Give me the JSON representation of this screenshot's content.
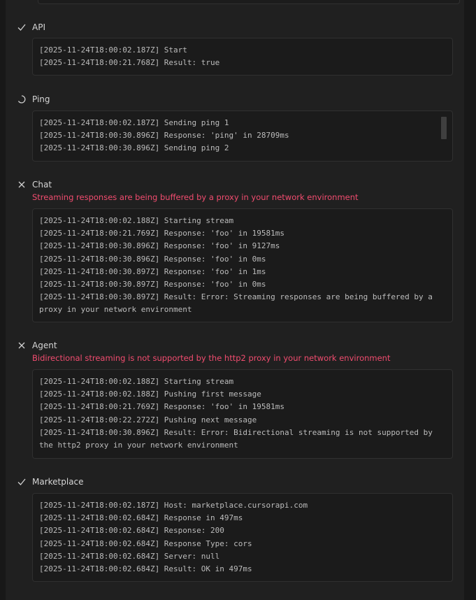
{
  "sections": [
    {
      "title": "API",
      "status": "success",
      "lines": [
        "[2025-11-24T18:00:02.187Z] Start",
        "[2025-11-24T18:00:21.768Z] Result: true"
      ]
    },
    {
      "title": "Ping",
      "status": "pending",
      "lines": [
        "[2025-11-24T18:00:02.187Z] Sending ping 1",
        "[2025-11-24T18:00:30.896Z] Response: 'ping' in 28709ms",
        "[2025-11-24T18:00:30.896Z] Sending ping 2"
      ]
    },
    {
      "title": "Chat",
      "status": "error",
      "error": "Streaming responses are being buffered by a proxy in your network environment",
      "lines": [
        "[2025-11-24T18:00:02.188Z] Starting stream",
        "[2025-11-24T18:00:21.769Z] Response: 'foo' in 19581ms",
        "[2025-11-24T18:00:30.896Z] Response: 'foo' in 9127ms",
        "[2025-11-24T18:00:30.896Z] Response: 'foo' in 0ms",
        "[2025-11-24T18:00:30.897Z] Response: 'foo' in 1ms",
        "[2025-11-24T18:00:30.897Z] Response: 'foo' in 0ms",
        "[2025-11-24T18:00:30.897Z] Result: Error: Streaming responses are being buffered by a proxy in your network environment"
      ]
    },
    {
      "title": "Agent",
      "status": "error",
      "error": "Bidirectional streaming is not supported by the http2 proxy in your network environment",
      "lines": [
        "[2025-11-24T18:00:02.188Z] Starting stream",
        "[2025-11-24T18:00:02.188Z] Pushing first message",
        "[2025-11-24T18:00:21.769Z] Response: 'foo' in 19581ms",
        "[2025-11-24T18:00:22.272Z] Pushing next message",
        "[2025-11-24T18:00:30.896Z] Result: Error: Bidirectional streaming is not supported by the http2 proxy in your network environment"
      ]
    },
    {
      "title": "Marketplace",
      "status": "success",
      "lines": [
        "[2025-11-24T18:00:02.187Z] Host: marketplace.cursorapi.com",
        "[2025-11-24T18:00:02.684Z] Response in 497ms",
        "[2025-11-24T18:00:02.684Z] Response: 200",
        "[2025-11-24T18:00:02.684Z] Response Type: cors",
        "[2025-11-24T18:00:02.684Z] Server: null",
        "[2025-11-24T18:00:02.684Z] Result: OK in 497ms"
      ]
    }
  ]
}
